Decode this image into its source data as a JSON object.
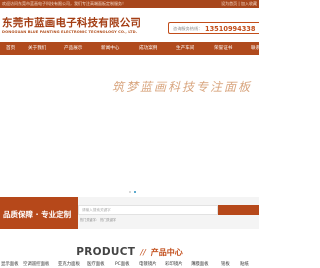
{
  "topbar": {
    "welcome": "欢迎访问东莞市蓝画电子科技有限公司，我们专注高端面板定制服务！",
    "links": "设为首页 | 加入收藏"
  },
  "header": {
    "logo_cn": "东莞市蓝画电子科技有限公司",
    "logo_en": "DONGGUAN BLUE PAINTING ELECTRONIC TECHNOLOGY CO., LTD.",
    "hotline_label": "咨询服务热线：",
    "hotline_number": "13510994338"
  },
  "nav": {
    "items": [
      "首页",
      "关于我们",
      "产品展示",
      "新闻中心",
      "成功案例",
      "生产车间",
      "荣誉证书",
      "联系我们"
    ]
  },
  "banner": {
    "calligraphy": [
      "筑",
      "梦",
      "蓝",
      "画",
      "科",
      "技",
      "专",
      "注",
      "面",
      "板"
    ],
    "slide_count": 2,
    "active_slide": 2
  },
  "promo": {
    "slogan": "品质保障 · 专业定制",
    "search_placeholder": "请输入搜索关键字",
    "hot_words": "热门关键字：   热门关键字"
  },
  "product": {
    "title_en": "PRODUCT",
    "separator": "//",
    "title_cn": "产品中心"
  },
  "categories": [
    "显示面板",
    "空调遥控面板",
    "亚克力面板",
    "医疗面板",
    "PC面板",
    "电镀镜片",
    "彩印镜片",
    "薄膜面板",
    "铭板",
    "贴纸"
  ],
  "colors": {
    "brand": "#b04a1d",
    "accent": "#c24d1a",
    "dot_active": "#2a8fbf"
  }
}
